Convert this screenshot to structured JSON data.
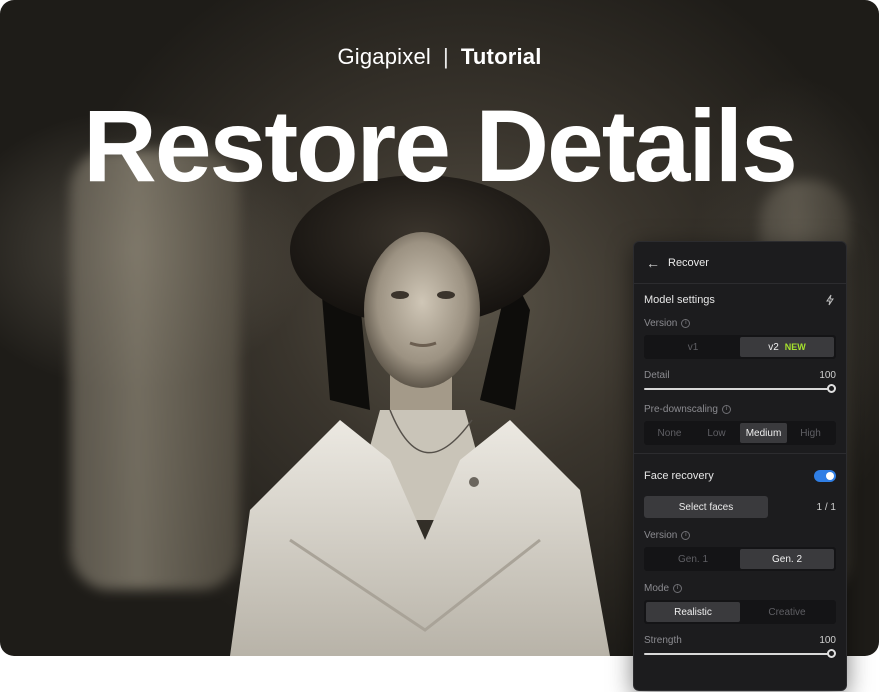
{
  "heading": {
    "brand": "Gigapixel",
    "separator": "|",
    "section": "Tutorial",
    "title": "Restore Details"
  },
  "panel": {
    "title": "Recover",
    "model_settings": {
      "label": "Model settings",
      "version_label": "Version",
      "versions": [
        "v1",
        "v2"
      ],
      "selected_version": "v2",
      "new_badge": "NEW",
      "detail_label": "Detail",
      "detail_value": "100",
      "predownscaling_label": "Pre-downscaling",
      "predownscaling_options": [
        "None",
        "Low",
        "Medium",
        "High"
      ],
      "predownscaling_selected": "Medium"
    },
    "face_recovery": {
      "label": "Face recovery",
      "enabled": true,
      "select_faces_label": "Select faces",
      "faces_count": "1 / 1",
      "version_label": "Version",
      "versions": [
        "Gen. 1",
        "Gen. 2"
      ],
      "selected_version": "Gen. 2",
      "mode_label": "Mode",
      "modes": [
        "Realistic",
        "Creative"
      ],
      "selected_mode": "Realistic",
      "strength_label": "Strength",
      "strength_value": "100"
    }
  },
  "icons": {
    "back": "arrow-left-icon",
    "model": "lightning-icon",
    "info": "info-icon"
  },
  "colors": {
    "accent_toggle": "#2f7ee5",
    "new_badge": "#a6e22e",
    "panel_bg": "#1c1c1e"
  }
}
